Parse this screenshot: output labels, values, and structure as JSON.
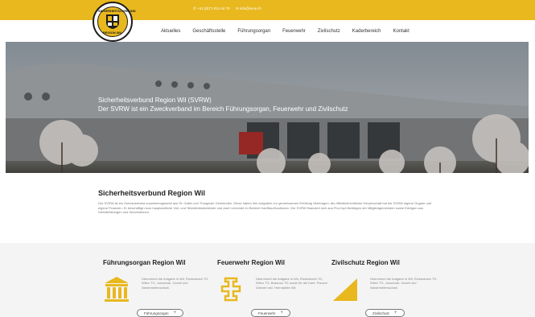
{
  "header": {
    "phone": "✆ +41 (0)71 913 44 78",
    "email": "✉ info@svrw.ch",
    "logo_text_top": "SICHERHEITSVERBUND",
    "logo_text_bottom": "REGION WIL"
  },
  "nav": {
    "items": [
      {
        "label": "Aktuelles"
      },
      {
        "label": "Geschäftsstelle"
      },
      {
        "label": "Führungsorgan"
      },
      {
        "label": "Feuerwehr"
      },
      {
        "label": "Zivilschutz"
      },
      {
        "label": "Kaderbereich"
      },
      {
        "label": "Kontakt"
      }
    ]
  },
  "hero": {
    "title": "Sicherheitsverbund Region Wil (SVRW)",
    "subtitle": "Der SVRW ist ein Zweckverband im Bereich Führungsorgan, Feuerwehr und Zivilschutz"
  },
  "intro": {
    "heading": "Sicherheitsverbund Region Wil",
    "text": "Der SVRW ist ein Zweckverband zusammengesetzt aus St. Galler und Thurgauer Gemeinden. Diese haben ihm Aufgaben zur gemeinsamen Erfüllung übertragen. Als öffentlichrechtliche Körperschaft hat der SVRW eigene Organe und eigene Finanzen. Er beschäftigt neun hauptamtliche Voll- und Teilzeitmitarbeitende und zwei Lernende im Bereich Kauffrau/Kaufmann. Der SVRW finanziert sich aus Pro-Kopf-Beiträgen der Mitgliedgemeinden sowie Erträgen aus Dienstleistungen und Subventionen."
  },
  "cards": [
    {
      "title": "Führungsorgan Region Wil",
      "icon": "pillars-icon",
      "text": "Übernimmt die Aufgabe in Wil, Rickenbach TG, Wilen TG, Jonschwil, Zuzwil und Niederhelfenschwil.",
      "button": "Führungsorgan"
    },
    {
      "title": "Feuerwehr Region Wil",
      "icon": "fire-hydrant-icon",
      "text": "Übernimmt die Aufgabe in Wil, Rickenbach TG, Wilen TG, Braunau TG sowie für die Kant. Pausch Dienste inkl. Hermatötte Wil.",
      "button": "Feuerwehr"
    },
    {
      "title": "Zivilschutz Region Wil",
      "icon": "triangle-icon",
      "text": "Übernimmt die Aufgabe in Wil, Rickenbach TG, Wilen TG, Jonschwil, Zuzwil und Niederhelfenschwil.",
      "button": "Zivilschutz"
    }
  ],
  "colors": {
    "accent": "#e8b81e",
    "dark": "#1d1d1d",
    "band": "#f4f4f4"
  }
}
